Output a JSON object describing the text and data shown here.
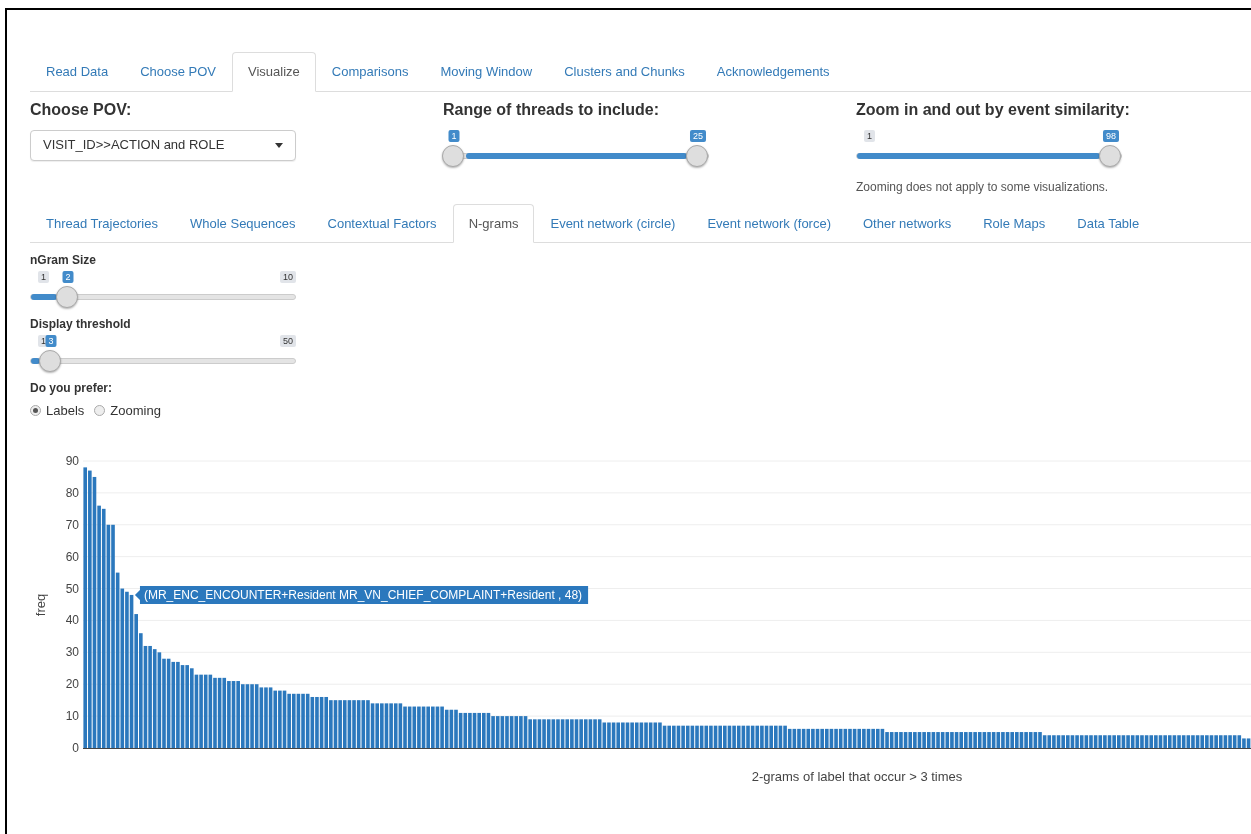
{
  "main_tabs": [
    {
      "label": "Read Data",
      "selected": false
    },
    {
      "label": "Choose POV",
      "selected": false
    },
    {
      "label": "Visualize",
      "selected": true
    },
    {
      "label": "Comparisons",
      "selected": false
    },
    {
      "label": "Moving Window",
      "selected": false
    },
    {
      "label": "Clusters and Chunks",
      "selected": false
    },
    {
      "label": "Acknowledgements",
      "selected": false
    }
  ],
  "controls": [
    {
      "kind": "select",
      "label": "Choose POV:",
      "value": "VISIT_ID>>ACTION and ROLE"
    },
    {
      "kind": "range",
      "label": "Range of threads to include:",
      "handles": [
        {
          "value": "1",
          "level": 0
        },
        {
          "value": "25",
          "level": 1
        }
      ]
    },
    {
      "kind": "slider",
      "label": "Zoom in and out by event similarity:",
      "min": "1",
      "value": "98",
      "level": 1,
      "note": "Zooming does not apply to some visualizations."
    }
  ],
  "sub_tabs": [
    {
      "label": "Thread Trajectories",
      "selected": false
    },
    {
      "label": "Whole Sequences",
      "selected": false
    },
    {
      "label": "Contextual Factors",
      "selected": false
    },
    {
      "label": "N-grams",
      "selected": true
    },
    {
      "label": "Event network (circle)",
      "selected": false
    },
    {
      "label": "Event network (force)",
      "selected": false
    },
    {
      "label": "Other networks",
      "selected": false
    },
    {
      "label": "Role Maps",
      "selected": false
    },
    {
      "label": "Data Table",
      "selected": false
    }
  ],
  "settings": [
    {
      "kind": "slider",
      "label": "nGram Size",
      "min": "1",
      "max": "10",
      "value": "2",
      "level": 0.111
    },
    {
      "kind": "slider",
      "label": "Display threshold",
      "min": "1",
      "max": "50",
      "value": "3",
      "level": 0.041
    },
    {
      "kind": "radio",
      "label": "Do you prefer:",
      "options": [
        {
          "label": "Labels",
          "selected": true
        },
        {
          "label": "Zooming",
          "selected": false
        }
      ]
    }
  ],
  "chart": {
    "chart_data": {
      "type": "bar",
      "grid": true,
      "ylabel": "freq",
      "xlabel": "2-grams of label that occur > 3 times",
      "ylim": [
        0,
        90
      ],
      "yticks": [
        0,
        10,
        20,
        30,
        40,
        50,
        60,
        70,
        80,
        90
      ],
      "series": [
        {
          "color": "#2b78bd",
          "values": [
            88,
            87,
            85,
            76,
            75,
            70,
            70,
            55,
            50,
            49,
            48,
            42,
            36,
            32,
            32,
            31,
            30,
            28,
            28,
            27,
            27,
            26,
            26,
            25,
            23,
            23,
            23,
            23,
            22,
            22,
            22,
            21,
            21,
            21,
            20,
            20,
            20,
            20,
            19,
            19,
            19,
            18,
            18,
            18,
            17,
            17,
            17,
            17,
            17,
            16,
            16,
            16,
            16,
            15,
            15,
            15,
            15,
            15,
            15,
            15,
            15,
            15,
            14,
            14,
            14,
            14,
            14,
            14,
            14,
            13,
            13,
            13,
            13,
            13,
            13,
            13,
            13,
            13,
            12,
            12,
            12,
            11,
            11,
            11,
            11,
            11,
            11,
            11,
            10,
            10,
            10,
            10,
            10,
            10,
            10,
            10,
            9,
            9,
            9,
            9,
            9,
            9,
            9,
            9,
            9,
            9,
            9,
            9,
            9,
            9,
            9,
            9,
            8,
            8,
            8,
            8,
            8,
            8,
            8,
            8,
            8,
            8,
            8,
            8,
            8,
            7,
            7,
            7,
            7,
            7,
            7,
            7,
            7,
            7,
            7,
            7,
            7,
            7,
            7,
            7,
            7,
            7,
            7,
            7,
            7,
            7,
            7,
            7,
            7,
            7,
            7,
            7,
            6,
            6,
            6,
            6,
            6,
            6,
            6,
            6,
            6,
            6,
            6,
            6,
            6,
            6,
            6,
            6,
            6,
            6,
            6,
            6,
            6,
            5,
            5,
            5,
            5,
            5,
            5,
            5,
            5,
            5,
            5,
            5,
            5,
            5,
            5,
            5,
            5,
            5,
            5,
            5,
            5,
            5,
            5,
            5,
            5,
            5,
            5,
            5,
            5,
            5,
            5,
            5,
            5,
            5,
            5,
            4,
            4,
            4,
            4,
            4,
            4,
            4,
            4,
            4,
            4,
            4,
            4,
            4,
            4,
            4,
            4,
            4,
            4,
            4,
            4,
            4,
            4,
            4,
            4,
            4,
            4,
            4,
            4,
            4,
            4,
            4,
            4,
            4,
            4,
            4,
            4,
            4,
            4,
            4,
            4,
            4,
            4,
            4,
            3,
            3
          ]
        }
      ],
      "annotations": [
        "(MR_ENC_ENCOUNTER+Resident MR_VN_CHIEF_COMPLAINT+Resident , 48)"
      ]
    }
  }
}
